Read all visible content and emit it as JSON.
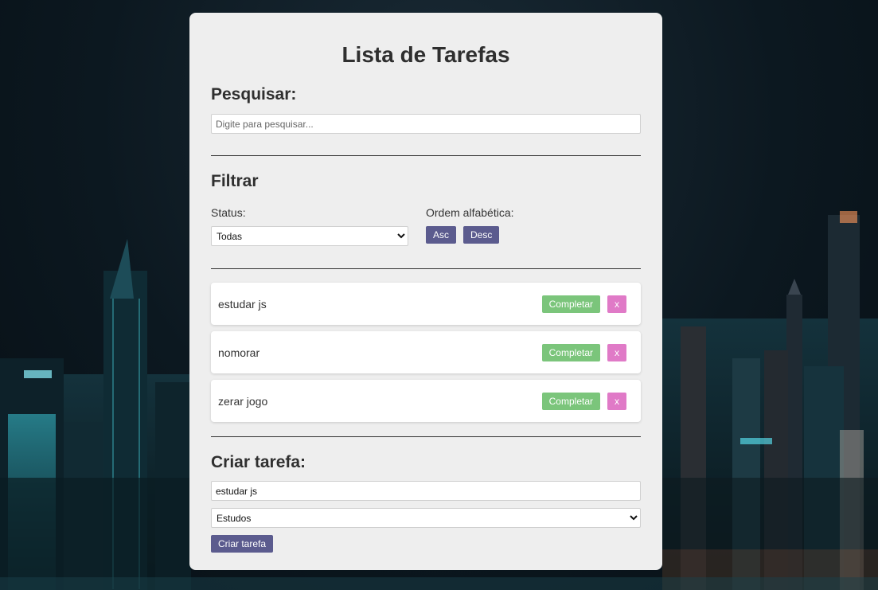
{
  "header": {
    "title": "Lista de Tarefas"
  },
  "search": {
    "heading": "Pesquisar:",
    "placeholder": "Digite para pesquisar...",
    "value": ""
  },
  "filter": {
    "heading": "Filtrar",
    "status_label": "Status:",
    "status_selected": "Todas",
    "order_label": "Ordem alfabética:",
    "asc_label": "Asc",
    "desc_label": "Desc"
  },
  "todos": [
    {
      "text": "estudar js",
      "complete_label": "Completar",
      "remove_label": "x"
    },
    {
      "text": "nomorar",
      "complete_label": "Completar",
      "remove_label": "x"
    },
    {
      "text": "zerar jogo",
      "complete_label": "Completar",
      "remove_label": "x"
    }
  ],
  "create": {
    "heading": "Criar tarefa:",
    "input_value": "estudar js",
    "category_selected": "Estudos",
    "button_label": "Criar tarefa"
  },
  "colors": {
    "panel_bg": "#eeeeee",
    "primary_button": "#5b5b8e",
    "complete_button": "#7bc57b",
    "remove_button": "#e07ac7"
  }
}
